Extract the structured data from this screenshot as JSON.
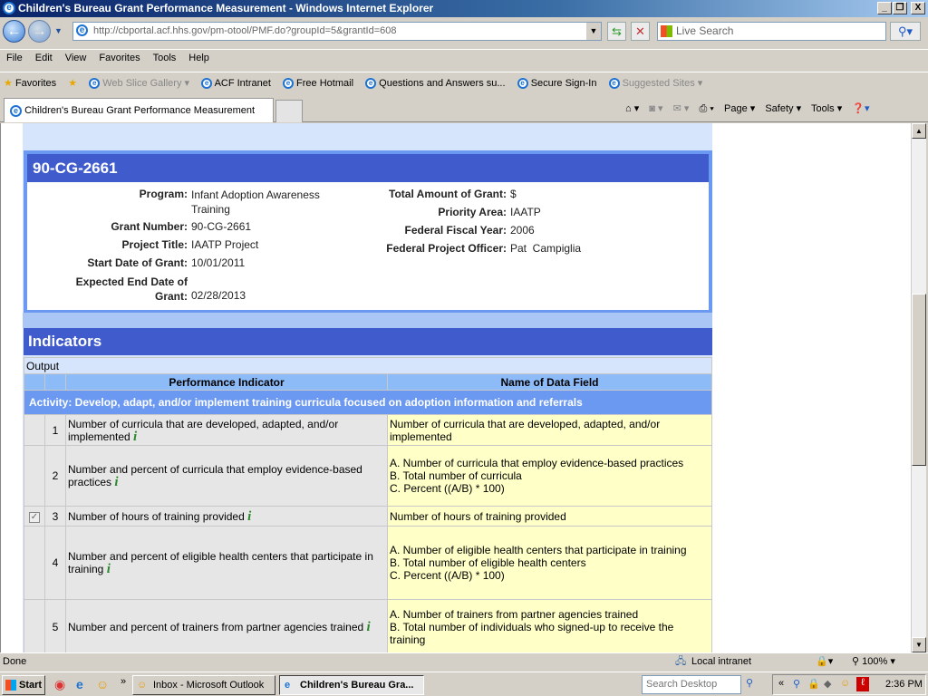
{
  "window": {
    "title": "Children's Bureau Grant Performance Measurement - Windows Internet Explorer",
    "min": "_",
    "max": "❐",
    "close": "X"
  },
  "address": {
    "url": "http://cbportal.acf.hhs.gov/pm-otool/PMF.do?groupId=5&grantId=608",
    "search_placeholder": "Live Search"
  },
  "menu": [
    "File",
    "Edit",
    "View",
    "Favorites",
    "Tools",
    "Help"
  ],
  "favorites": {
    "label": "Favorites",
    "items": [
      "Web Slice Gallery ▾",
      "ACF Intranet",
      "Free Hotmail",
      "Questions and Answers su...",
      "Secure Sign-In",
      "Suggested Sites ▾"
    ]
  },
  "tab": {
    "label": "Children's Bureau Grant Performance Measurement"
  },
  "commands": [
    "Page ▾",
    "Safety ▾",
    "Tools ▾"
  ],
  "grant": {
    "id": "90-CG-2661",
    "left": [
      {
        "label": "Program:",
        "value": "Infant Adoption Awareness Training"
      },
      {
        "label": "Grant Number:",
        "value": "90-CG-2661"
      },
      {
        "label": "Project Title:",
        "value": "IAATP Project"
      },
      {
        "label": "Start Date of Grant:",
        "value": "10/01/2011"
      },
      {
        "label": "Expected End Date of Grant:",
        "value": "02/28/2013"
      }
    ],
    "right": [
      {
        "label": "Total Amount of Grant:",
        "value": "$"
      },
      {
        "label": "Priority Area:",
        "value": "IAATP"
      },
      {
        "label": "Federal Fiscal Year:",
        "value": "2006"
      },
      {
        "label": "Federal Project Officer:",
        "value": "Pat  Campiglia"
      }
    ]
  },
  "indicators": {
    "title": "Indicators",
    "section": "Output",
    "col_indicator": "Performance Indicator",
    "col_field": "Name of Data Field",
    "activity": "Activity: Develop, adapt, and/or implement training curricula focused on adoption information and referrals",
    "rows": [
      {
        "num": "1",
        "checked": false,
        "indicator": "Number of curricula that are developed, adapted, and/or implemented",
        "fields": [
          "Number of curricula that are developed, adapted, and/or implemented"
        ]
      },
      {
        "num": "2",
        "checked": false,
        "indicator": "Number and percent of curricula that employ evidence-based practices",
        "fields": [
          "A. Number of curricula that employ evidence-based practices",
          "B. Total number of curricula",
          "C. Percent ((A/B) * 100)"
        ]
      },
      {
        "num": "3",
        "checked": true,
        "indicator": "Number of hours of training provided",
        "fields": [
          "Number of hours of training provided"
        ]
      },
      {
        "num": "4",
        "checked": false,
        "indicator": "Number and percent of eligible health centers that participate in training",
        "fields": [
          "A. Number of eligible health centers that participate in training",
          "B. Total number of eligible health centers",
          "C. Percent ((A/B) * 100)"
        ]
      },
      {
        "num": "5",
        "checked": false,
        "indicator": "Number and percent of trainers from partner agencies trained",
        "fields": [
          "A. Number of trainers from partner agencies trained",
          "B. Total number of individuals who signed-up to receive the training"
        ]
      }
    ]
  },
  "status": {
    "text": "Done",
    "zone": "Local intranet",
    "zoom": "100%"
  },
  "taskbar": {
    "start": "Start",
    "tasks": [
      "Inbox - Microsoft Outlook",
      "Children's Bureau Gra..."
    ],
    "search_placeholder": "Search Desktop",
    "clock": "2:36 PM"
  }
}
